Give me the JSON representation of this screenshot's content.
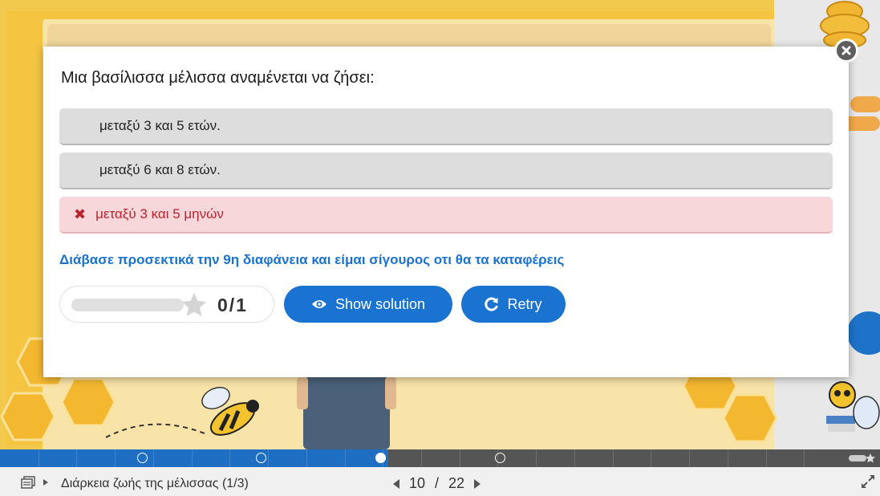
{
  "quiz": {
    "question": "Μια βασίλισσα μέλισσα αναμένεται να ζήσει:",
    "answers": [
      {
        "label": "μεταξύ 3 και 5 ετών.",
        "state": "neutral"
      },
      {
        "label": "μεταξύ 6 και 8 ετών.",
        "state": "neutral"
      },
      {
        "label": "μεταξύ 3 και 5 μηνών",
        "state": "wrong"
      }
    ],
    "feedback": "Διάβασε προσεκτικά την 9η διαφάνεια και είμαι σίγουρος οτι θα τα καταφέρεις",
    "score": "0/1",
    "score_fraction": 0,
    "show_solution_label": "Show solution",
    "retry_label": "Retry"
  },
  "icons": {
    "close": "close-icon",
    "wrong": "x-mark-icon",
    "star": "star-icon",
    "eye": "eye-icon",
    "retry": "retry-icon",
    "slides": "slides-icon",
    "fullscreen": "exit-fullscreen-icon"
  },
  "footer": {
    "title": "Διάρκεια ζωής της μέλισσας (1/3)",
    "current_slide": "10",
    "separator": "/",
    "total_slides": "22"
  },
  "progress": {
    "current_slide": 10,
    "total_slides": 22
  },
  "colors": {
    "accent": "#1a73d0",
    "wrong_bg": "#f8d7da",
    "wrong_text": "#b8232f",
    "slide_bg": "#f5c542"
  }
}
